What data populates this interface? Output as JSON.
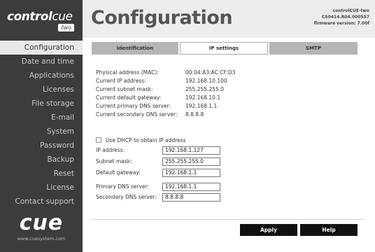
{
  "brand": {
    "top_logo_bold": "control",
    "top_logo_thin": "cue",
    "top_logo_badge": "two",
    "bottom_logo": "cue",
    "bottom_url": "www.cuesystem.com"
  },
  "sidebar": {
    "items": [
      {
        "label": "Configuration",
        "active": true
      },
      {
        "label": "Date and time"
      },
      {
        "label": "Applications"
      },
      {
        "label": "Licenses"
      },
      {
        "label": "File storage"
      },
      {
        "label": "E-mail"
      },
      {
        "label": "System"
      },
      {
        "label": "Password"
      },
      {
        "label": "Backup"
      },
      {
        "label": "Reset"
      },
      {
        "label": "License"
      },
      {
        "label": "Contact support"
      }
    ]
  },
  "header": {
    "title": "Configuration",
    "device_name": "controlCUE-two",
    "serial": "CS0414.R04.000557",
    "firmware": "firmware version: 7.00f"
  },
  "tabs": [
    {
      "label": "Identification"
    },
    {
      "label": "IP settings",
      "active": true
    },
    {
      "label": "SMTP"
    }
  ],
  "info": [
    {
      "label": "Physical address (MAC):",
      "value": "00:04:A3:AC:CF:D3"
    },
    {
      "label": "Current IP address:",
      "value": "192.168.10.100"
    },
    {
      "label": "Current subnet mask:",
      "value": "255.255.255.0"
    },
    {
      "label": "Current default gateway:",
      "value": "192.168.10.1"
    },
    {
      "label": "Current primary DNS server:",
      "value": "192.168.1.1"
    },
    {
      "label": "Current secondary DNS server:",
      "value": "8.8.8.8"
    }
  ],
  "dhcp": {
    "label": "Use DHCP to obtain IP address",
    "checked": false
  },
  "form": {
    "ip_label": "IP address:",
    "ip_value": "192.168.1.127",
    "mask_label": "Subnet mask:",
    "mask_value": "255.255.255.0",
    "gateway_label": "Default gateway:",
    "gateway_value": "192.168.1.1",
    "dns1_label": "Primary DNS server:",
    "dns1_value": "192.168.1.1",
    "dns2_label": "Secondary DNS server:",
    "dns2_value": "8.8.8.8"
  },
  "buttons": {
    "apply": "Apply",
    "help": "Help"
  }
}
